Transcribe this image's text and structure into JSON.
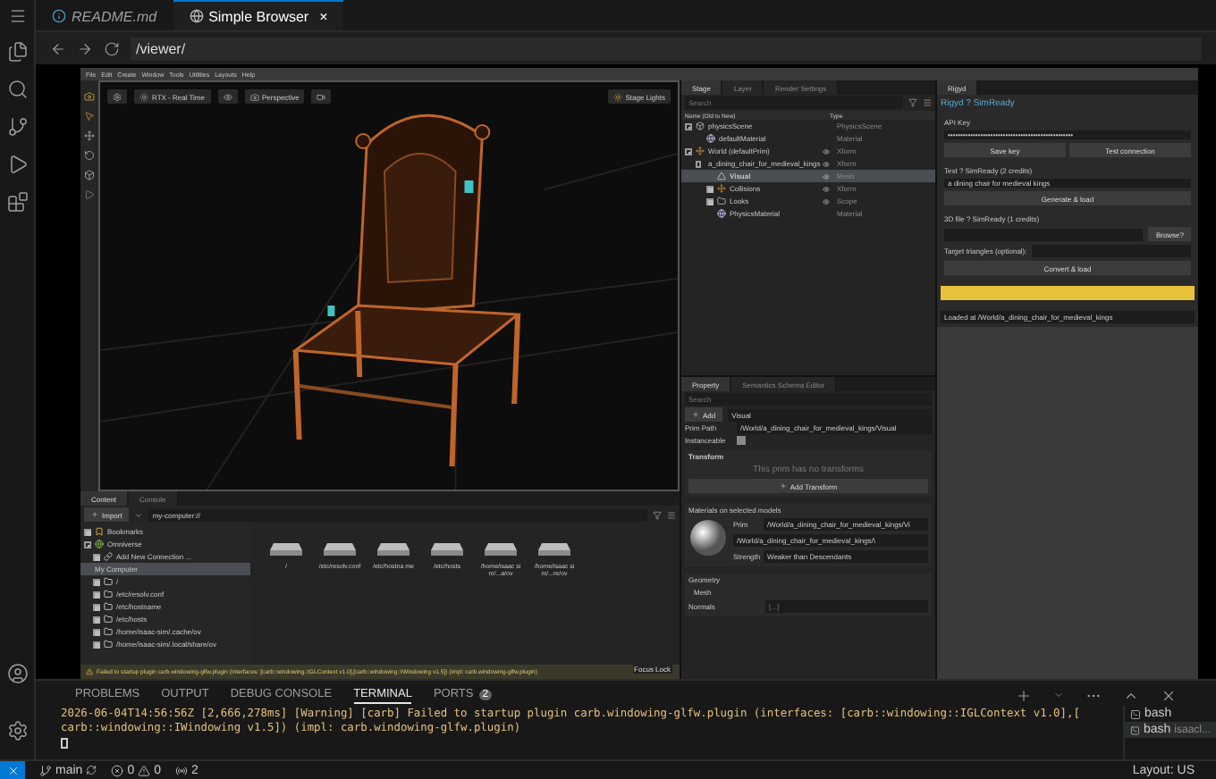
{
  "editor_tabs": [
    {
      "label": "README.md",
      "kind": "markdown",
      "selected": false
    },
    {
      "label": "Simple Browser",
      "kind": "browser",
      "selected": true,
      "close": "×"
    }
  ],
  "address_bar": {
    "url": "/viewer/"
  },
  "app": {
    "menu": [
      "File",
      "Edit",
      "Create",
      "Window",
      "Tools",
      "Utilities",
      "Layouts",
      "Help"
    ],
    "viewport": {
      "toolbar": [
        "RTX - Real Time",
        "Perspective"
      ],
      "stage_lights": "Stage Lights"
    },
    "content": {
      "tabs": [
        {
          "label": "Content",
          "selected": true
        },
        {
          "label": "Console",
          "selected": false
        }
      ],
      "import": "Import",
      "path": "my-computer://",
      "tree": [
        {
          "label": "Bookmarks",
          "kind": "bookmark",
          "expanded": false
        },
        {
          "label": "Omniverse",
          "kind": "omniverse",
          "expanded": true,
          "children": [
            {
              "label": "Add New Connection ...",
              "kind": "connection",
              "expanded": false
            }
          ]
        },
        {
          "label": "My Computer",
          "kind": "computer",
          "selected": true,
          "children": [
            {
              "label": "/",
              "kind": "folder",
              "expanded": false
            },
            {
              "label": "/etc/resolv.conf",
              "kind": "folder",
              "expanded": false
            },
            {
              "label": "/etc/hostname",
              "kind": "folder",
              "expanded": false
            },
            {
              "label": "/etc/hosts",
              "kind": "folder",
              "expanded": false
            },
            {
              "label": "/home/isaac-sim/.cache/ov",
              "kind": "folder",
              "expanded": false
            },
            {
              "label": "/home/isaac-sim/.local/share/ov",
              "kind": "folder",
              "expanded": false
            }
          ]
        }
      ],
      "files": [
        "/",
        "/etc/resolv.conf",
        "/etc/hostna me",
        "/etc/hosts",
        "/home/isaac sim/...a/ov",
        "/home/isaac sim/...re/ov"
      ]
    },
    "warning": "Failed to startup plugin carb.windowing-glfw.plugin (interfaces: [carb::windowing::IGLContext v1.0],[carb::windowing::IWindowing v1.5]) (impl: carb.windowing-glfw.plugin)",
    "focus_lock": "Focus Lock",
    "stage": {
      "tabs": [
        {
          "label": "Stage",
          "selected": true
        },
        {
          "label": "Layer",
          "selected": false
        },
        {
          "label": "Render Settings",
          "selected": false
        }
      ],
      "search": {
        "placeholder": "Search"
      },
      "columns": [
        "Name (Old to New)",
        "Type"
      ],
      "tree": [
        {
          "label": "physicsScene",
          "type": "PhysicsScene",
          "kind": "scene",
          "expanded": true,
          "visible": false,
          "selected": false,
          "children": [
            {
              "label": "defaultMaterial",
              "type": "Material",
              "kind": "material",
              "visible": false,
              "selected": false
            }
          ]
        },
        {
          "label": "World (defaultPrim)",
          "type": "Xform",
          "kind": "xform",
          "expanded": true,
          "visible": true,
          "selected": false,
          "children": [
            {
              "label": "a_dining_chair_for_medieval_kings",
              "type": "Xform",
              "kind": "xform",
              "expanded": true,
              "visible": true,
              "selected": false,
              "children": [
                {
                  "label": "Visual",
                  "type": "Mesh",
                  "kind": "mesh",
                  "visible": true,
                  "selected": true
                },
                {
                  "label": "Collisions",
                  "type": "Xform",
                  "kind": "xform",
                  "expanded": false,
                  "visible": true,
                  "selected": false
                },
                {
                  "label": "Looks",
                  "type": "Scope",
                  "kind": "folder",
                  "expanded": false,
                  "visible": true,
                  "selected": false
                },
                {
                  "label": "PhysicsMaterial",
                  "type": "Material",
                  "kind": "material",
                  "visible": false,
                  "selected": false
                }
              ]
            }
          ]
        }
      ]
    },
    "property": {
      "tabs": [
        {
          "label": "Property",
          "selected": true
        },
        {
          "label": "Semantics Schema Editor",
          "selected": false
        }
      ],
      "search": {
        "placeholder": "Search"
      },
      "add": "Add",
      "name": "Visual",
      "prim_path_label": "Prim Path",
      "prim_path": "/World/a_dining_chair_for_medieval_kings/Visual",
      "instanceable_label": "Instanceable",
      "instanceable": false,
      "transform": {
        "title": "Transform",
        "note": "This prim has no transforms",
        "button": "Add Transform"
      },
      "materials": {
        "title": "Materials on selected models",
        "prim_label": "Prim",
        "prim": "/World/a_dining_chair_for_medieval_kings/Vi",
        "material": "/World/a_dining_chair_for_medieval_kings/\\",
        "strength_label": "Strength",
        "strength": "Weaker than Descendants"
      },
      "geometry": {
        "title": "Geometry",
        "mesh": "Mesh",
        "normals_label": "Normals",
        "normals": "[...]"
      }
    },
    "rigyd": {
      "tab": "Rigyd",
      "title": "Rigyd ? SimReady",
      "api": {
        "title": "API Key",
        "value": "••••••••••••••••••••••••••••••••••••••••••••••••••",
        "buttons": [
          "Save key",
          "Test connection"
        ]
      },
      "text": {
        "title": "Text ? SimReady (2 credits)",
        "value": "a dining chair for medieval kings",
        "button": "Generate & load"
      },
      "file": {
        "title": "3D file ? SimReady (1 credits)",
        "browse": "Browse?",
        "target_label": "Target triangles (optional):",
        "button": "Convert & load"
      },
      "progress": {
        "level": 1
      },
      "status": "Loaded at /World/a_dining_chair_for_medieval_kings"
    }
  },
  "panel": {
    "tabs": [
      {
        "label": "PROBLEMS",
        "selected": false
      },
      {
        "label": "OUTPUT",
        "selected": false
      },
      {
        "label": "DEBUG CONSOLE",
        "selected": false
      },
      {
        "label": "TERMINAL",
        "selected": true
      },
      {
        "label": "PORTS",
        "selected": false,
        "badge": "2"
      }
    ],
    "terminal": [
      "2026-06-04T14:56:56Z [2,666,278ms] [Warning] [carb] Failed to startup plugin carb.windowing-glfw.plugin (interfaces: [carb::windowing::IGLContext v1.0],[",
      "carb::windowing::IWindowing v1.5]) (impl: carb.windowing-glfw.plugin)"
    ],
    "terminals": [
      {
        "label": "bash",
        "selected": false
      },
      {
        "label": "bash",
        "detail": "isaacl...",
        "selected": true
      }
    ]
  },
  "status_bar": {
    "branch": "main",
    "errors": "0",
    "warnings": "0",
    "ports": "2",
    "layout": "Layout: US"
  }
}
